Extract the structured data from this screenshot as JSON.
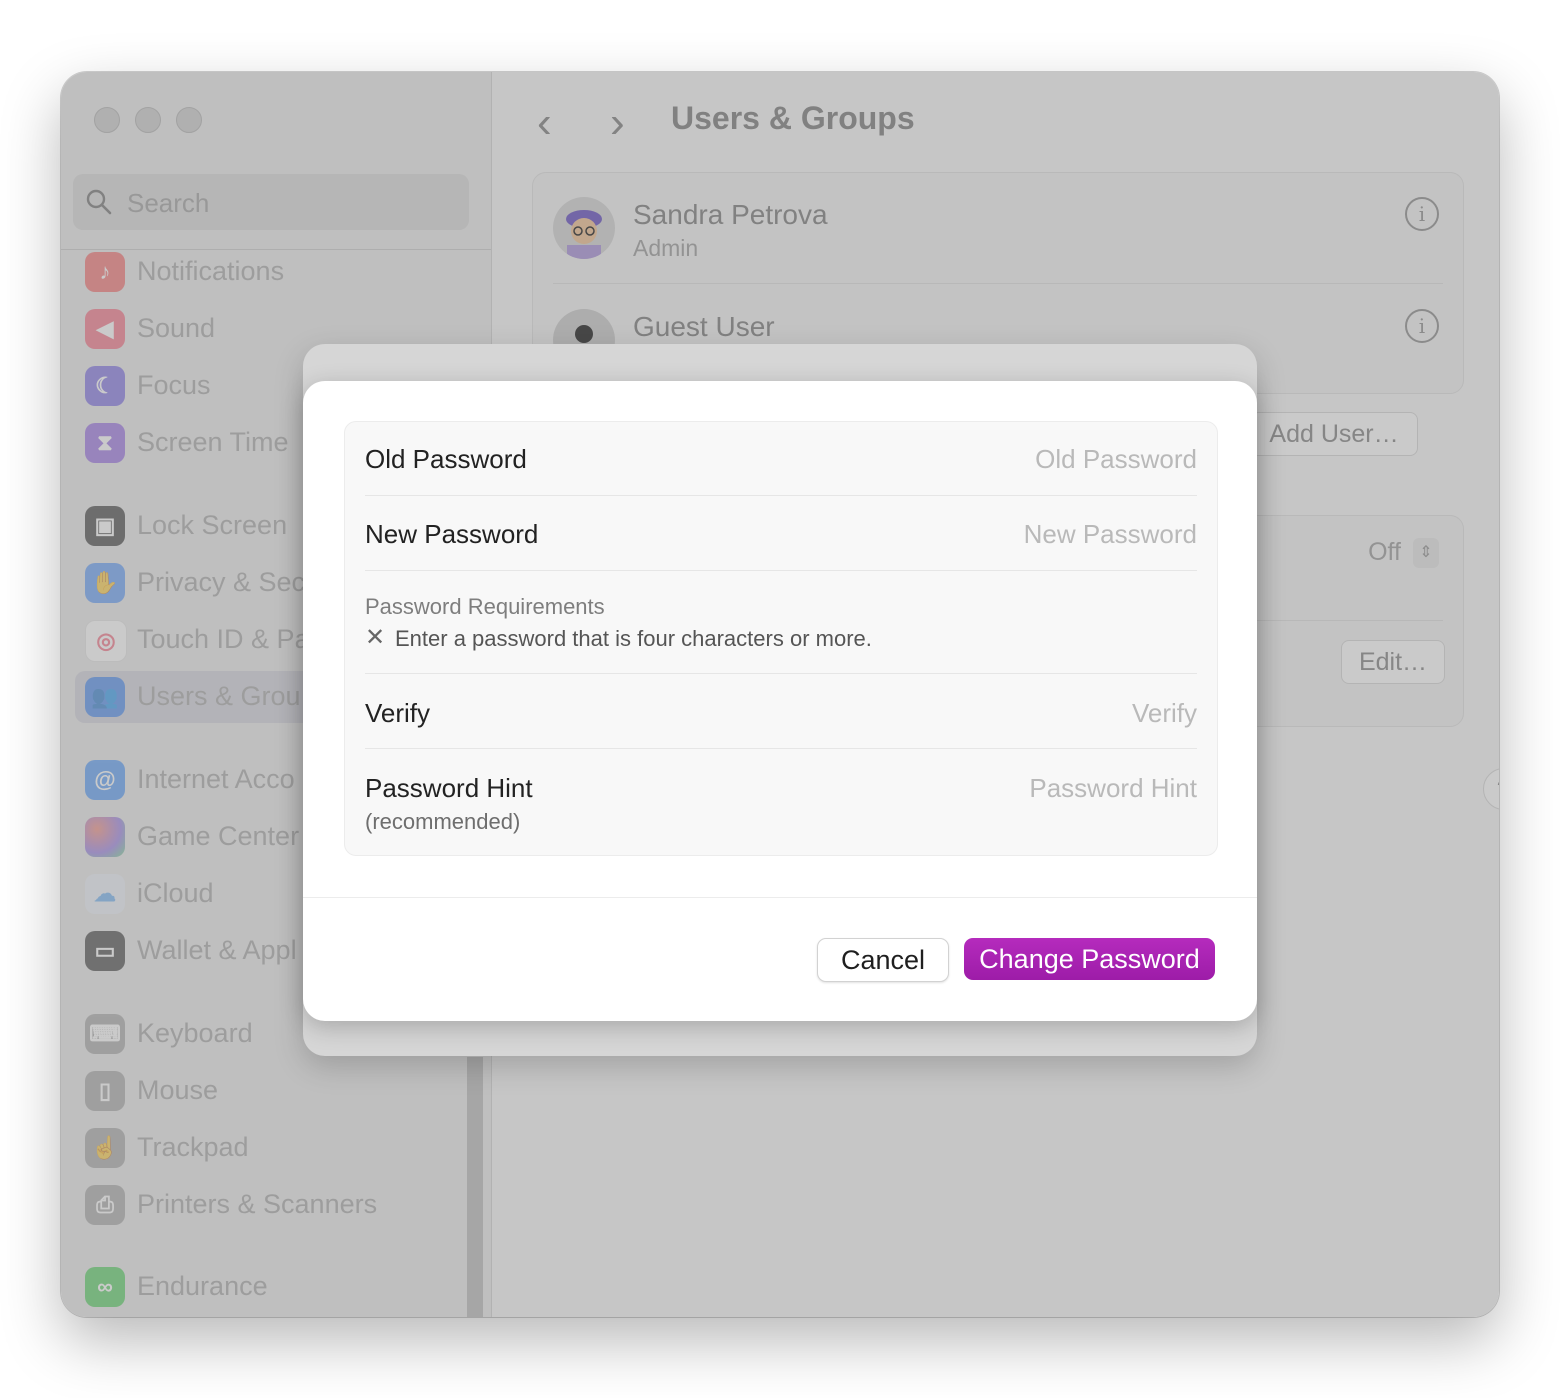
{
  "window": {
    "title": "Users & Groups"
  },
  "sidebar": {
    "search_placeholder": "Search",
    "items": [
      {
        "label": "Notifications",
        "icon": "bell-icon",
        "color": "#f25a5a"
      },
      {
        "label": "Sound",
        "icon": "speaker-icon",
        "color": "#f25a72"
      },
      {
        "label": "Focus",
        "icon": "moon-icon",
        "color": "#6a5ae0"
      },
      {
        "label": "Screen Time",
        "icon": "hourglass-icon",
        "color": "#8a5ae0"
      },
      {
        "label": "Lock Screen",
        "icon": "lock-icon",
        "color": "#222222"
      },
      {
        "label": "Privacy & Sec",
        "icon": "hand-icon",
        "color": "#4a8ef5"
      },
      {
        "label": "Touch ID & Pa",
        "icon": "fingerprint-icon",
        "color": "#ffffff"
      },
      {
        "label": "Users & Grou",
        "icon": "users-icon",
        "color": "#3a84f0"
      },
      {
        "label": "Internet Acco",
        "icon": "at-icon",
        "color": "#3a8cf5"
      },
      {
        "label": "Game Center",
        "icon": "game-center-icon",
        "color": "#f27a6a"
      },
      {
        "label": "iCloud",
        "icon": "cloud-icon",
        "color": "#5aa6f0"
      },
      {
        "label": "Wallet & Appl",
        "icon": "wallet-icon",
        "color": "#2a2a2a"
      },
      {
        "label": "Keyboard",
        "icon": "keyboard-icon",
        "color": "#9a9a9a"
      },
      {
        "label": "Mouse",
        "icon": "mouse-icon",
        "color": "#9a9a9a"
      },
      {
        "label": "Trackpad",
        "icon": "trackpad-icon",
        "color": "#9a9a9a"
      },
      {
        "label": "Printers & Scanners",
        "icon": "printer-icon",
        "color": "#9a9a9a"
      },
      {
        "label": "Endurance",
        "icon": "endurance-icon",
        "color": "#3cc84a"
      }
    ]
  },
  "users": [
    {
      "name": "Sandra Petrova",
      "role": "Admin"
    },
    {
      "name": "Guest User",
      "role": ""
    }
  ],
  "background_buttons": {
    "add_user": "Add User…",
    "autologin_value": "Off",
    "edit": "Edit…",
    "help": "?"
  },
  "dialog": {
    "old_password_label": "Old Password",
    "old_password_placeholder": "Old Password",
    "new_password_label": "New Password",
    "new_password_placeholder": "New Password",
    "requirements_title": "Password Requirements",
    "requirement_text": "Enter a password that is four characters or more.",
    "verify_label": "Verify",
    "verify_placeholder": "Verify",
    "hint_label": "Password Hint",
    "hint_sub": "(recommended)",
    "hint_placeholder": "Password Hint",
    "cancel_label": "Cancel",
    "change_label": "Change Password",
    "accent_color": "#a821b3"
  }
}
